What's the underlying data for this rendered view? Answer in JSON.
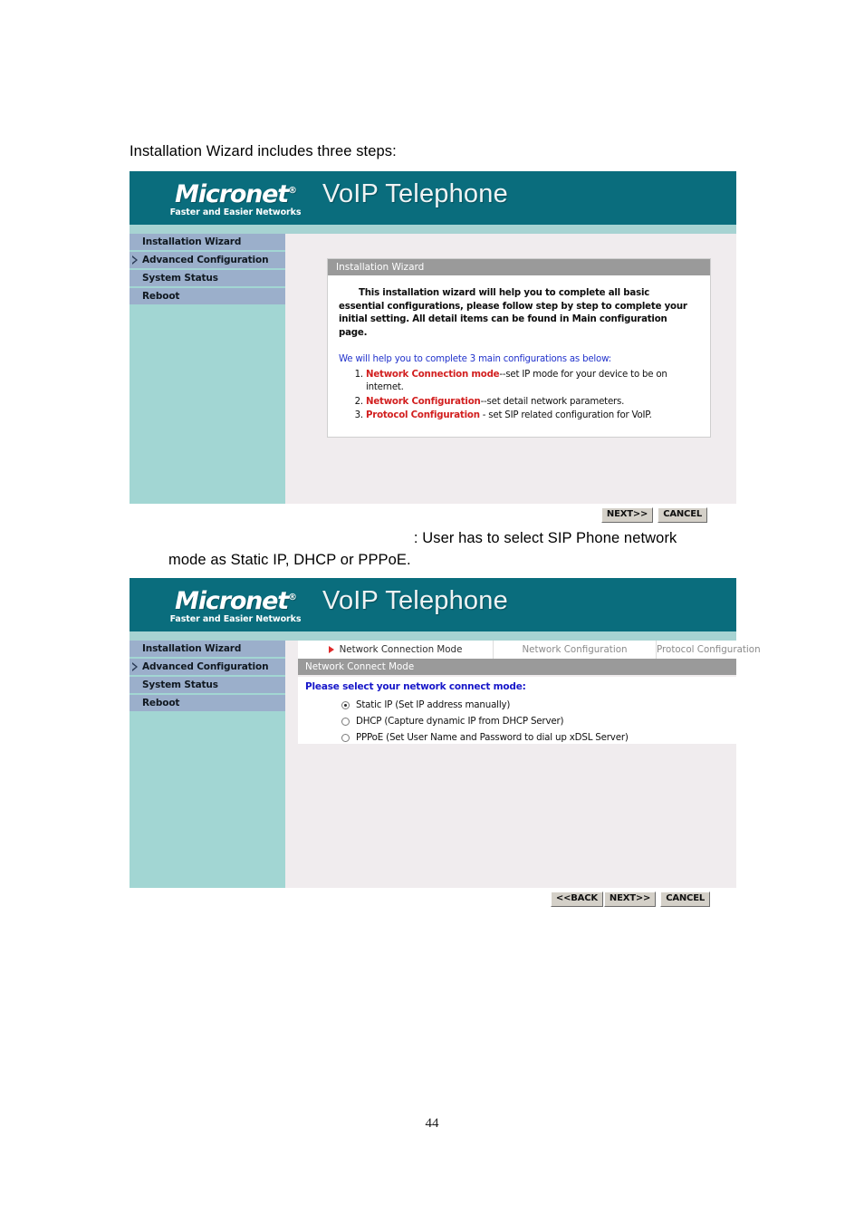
{
  "document": {
    "intro_text": "Installation Wizard includes three steps:",
    "caption_line1": ": User has to select SIP Phone network",
    "caption_line2": "mode as Static IP, DHCP or PPPoE.",
    "page_number": "44"
  },
  "colors": {
    "brand_teal": "#0a6d7d",
    "brand_underline": "#a7d3d2",
    "sidebar_bg": "#a2d6d3",
    "nav_item_bg": "#9bafcb",
    "panel_bg": "#f0ecee",
    "section_bar": "#9a9a9a",
    "link_blue": "#2233cc",
    "keyword_red": "#d21f1f",
    "prompt_blue": "#1717c9",
    "button_face": "#d4d0c8"
  },
  "screen1": {
    "brand": {
      "logo_word": "Micronet",
      "logo_registered": "®",
      "logo_tagline": "Faster and Easier Networks",
      "title": "VoIP Telephone"
    },
    "sidebar": {
      "items": [
        {
          "label": "Installation Wizard",
          "arrow": false
        },
        {
          "label": "Advanced Configuration",
          "arrow": true
        },
        {
          "label": "System Status",
          "arrow": false
        },
        {
          "label": "Reboot",
          "arrow": false
        }
      ]
    },
    "card": {
      "header": "Installation Wizard",
      "paragraph": "This installation wizard will help you to complete all basic essential configurations, please follow step by step to complete your initial setting. All detail items can be found in Main configuration page.",
      "lead": "We will help you to complete 3 main configurations as below:",
      "items": [
        {
          "keyword": "Network Connection mode",
          "rest": "--set IP mode for your device to be on internet."
        },
        {
          "keyword": "Network Configuration",
          "rest": "--set detail network parameters."
        },
        {
          "keyword": "Protocol Configuration",
          "rest": " - set SIP related configuration for VoIP."
        }
      ]
    },
    "buttons": {
      "next": "NEXT>>",
      "cancel": "CANCEL"
    }
  },
  "screen2": {
    "brand": {
      "logo_word": "Micronet",
      "logo_registered": "®",
      "logo_tagline": "Faster and Easier Networks",
      "title": "VoIP Telephone"
    },
    "sidebar": {
      "items": [
        {
          "label": "Installation Wizard",
          "arrow": false
        },
        {
          "label": "Advanced Configuration",
          "arrow": true
        },
        {
          "label": "System Status",
          "arrow": false
        },
        {
          "label": "Reboot",
          "arrow": false
        }
      ]
    },
    "tabs": [
      {
        "label": "Network Connection Mode",
        "active": true
      },
      {
        "label": "Network Configuration",
        "active": false
      },
      {
        "label": "Protocol Configuration",
        "active": false
      }
    ],
    "section_title": "Network Connect Mode",
    "prompt": "Please select your network connect mode:",
    "options": [
      {
        "label": "Static IP (Set IP address manually)",
        "selected": true
      },
      {
        "label": "DHCP (Capture dynamic IP from DHCP Server)",
        "selected": false
      },
      {
        "label": "PPPoE (Set User Name and Password to dial up xDSL Server)",
        "selected": false
      }
    ],
    "buttons": {
      "back": "<<BACK",
      "next": "NEXT>>",
      "cancel": "CANCEL"
    }
  }
}
